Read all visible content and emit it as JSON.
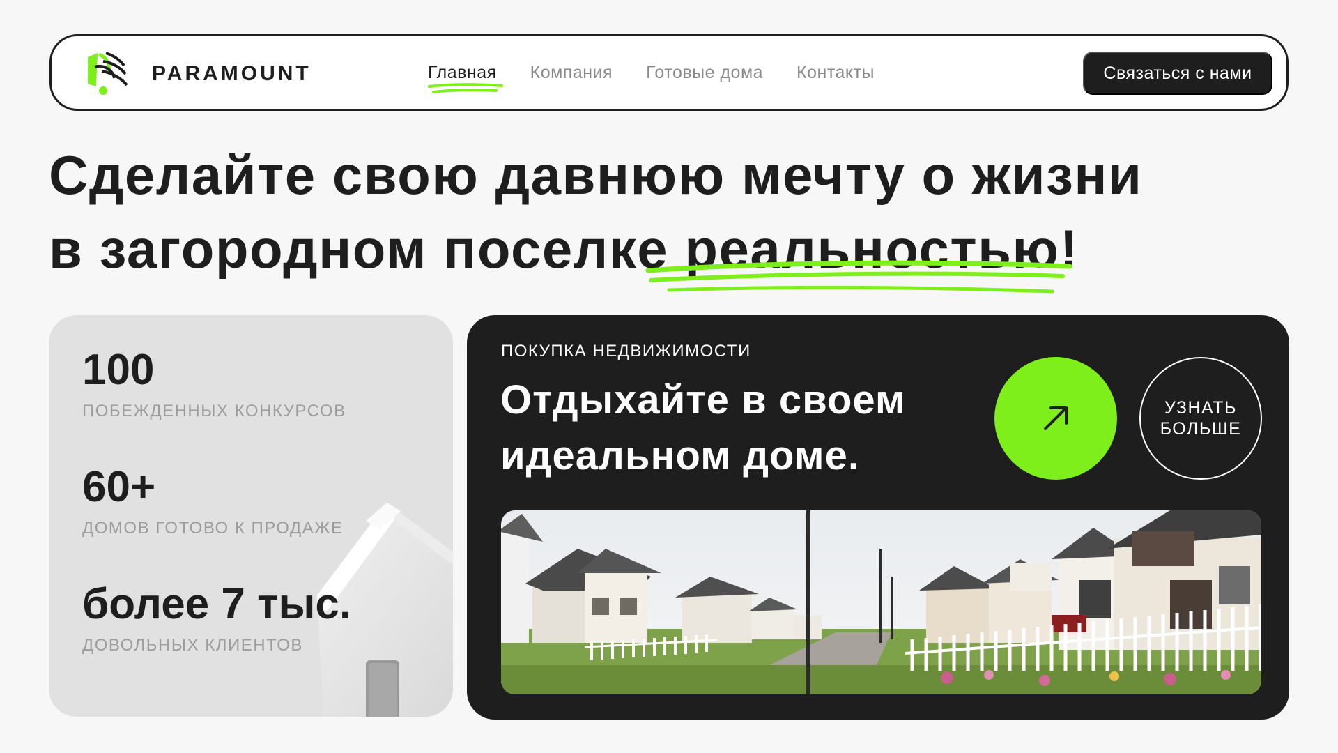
{
  "colors": {
    "accent": "#7eef1a",
    "dark": "#1e1e1e",
    "muted": "#8a8a8a",
    "background": "#f7f7f7",
    "card_gray": "#e1e1e1"
  },
  "header": {
    "logo_text": "PARAMOUNT",
    "logo_icon": "paramount-logo-icon",
    "nav": [
      {
        "label": "Главная",
        "active": true
      },
      {
        "label": "Компания",
        "active": false
      },
      {
        "label": "Готовые дома",
        "active": false
      },
      {
        "label": "Контакты",
        "active": false
      }
    ],
    "cta_label": "Связаться с нами"
  },
  "hero": {
    "line1": "Сделайте свою давнюю мечту о жизни",
    "line2_prefix": "в загородном поселке ",
    "line2_highlight": "реальностью",
    "line2_suffix": "!"
  },
  "stats": [
    {
      "value": "100",
      "label": "ПОБЕЖДЕННЫХ КОНКУРСОВ"
    },
    {
      "value": "60+",
      "label": "ДОМОВ ГОТОВО К ПРОДАЖЕ"
    },
    {
      "value": "более 7 тыс.",
      "label": "ДОВОЛЬНЫХ КЛИЕНТОВ"
    }
  ],
  "feature": {
    "kicker": "ПОКУПКА НЕДВИЖИМОСТИ",
    "title": "Отдыхайте в своем идеальном доме.",
    "arrow_icon": "arrow-up-right-icon",
    "more_label": "УЗНАТЬ\nБОЛЬШЕ",
    "photo_subject": "suburban-houses-street"
  }
}
